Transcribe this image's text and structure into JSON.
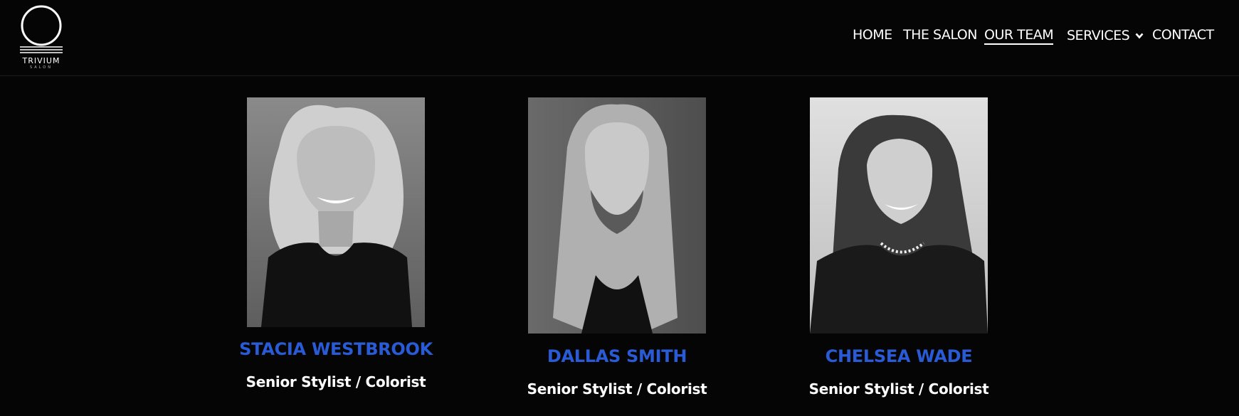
{
  "brand": {
    "name": "TRIVIUM",
    "sub": "SALON"
  },
  "nav": {
    "items": [
      {
        "label": "HOME"
      },
      {
        "label": "THE SALON"
      },
      {
        "label": "OUR TEAM",
        "active": true
      },
      {
        "label": "SERVICES",
        "has_dropdown": true
      },
      {
        "label": "CONTACT"
      }
    ]
  },
  "team": [
    {
      "name": "STACIA WESTBROOK",
      "role": "Senior Stylist / Colorist"
    },
    {
      "name": "DALLAS SMITH",
      "role": "Senior Stylist / Colorist"
    },
    {
      "name": "CHELSEA WADE",
      "role": "Senior Stylist / Colorist"
    }
  ],
  "colors": {
    "background": "#050506",
    "accent_name": "#2a5bd7",
    "text": "#ffffff"
  },
  "icons": {
    "logo": "crescent-circle-logo",
    "dropdown": "chevron-down-icon"
  }
}
